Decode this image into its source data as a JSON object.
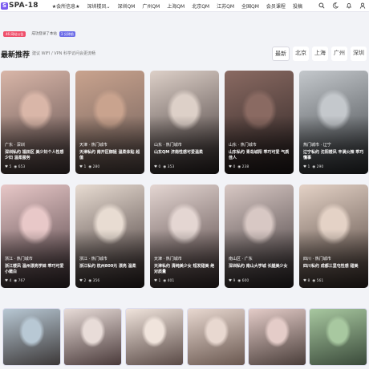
{
  "site": {
    "logo_letter": "S",
    "name": "SPA-18"
  },
  "nav": {
    "items": [
      {
        "label": "★会所信息★",
        "vip": true
      },
      {
        "label": "深圳楼凤⌄"
      },
      {
        "label": "深圳QM"
      },
      {
        "label": "广州QM"
      },
      {
        "label": "上海QM"
      },
      {
        "label": "北京QM"
      },
      {
        "label": "江苏QM"
      },
      {
        "label": "全国QM"
      },
      {
        "label": "会员课程"
      },
      {
        "label": "投稿"
      }
    ],
    "icons": [
      "search-icon",
      "moon-icon",
      "bell-icon",
      "user-icon"
    ]
  },
  "announce": {
    "tag": "46 网站公告",
    "text": "成功登录了本站",
    "time": "3 分钟前"
  },
  "section": {
    "title": "最新推荐",
    "subtitle": "建议 WIFI / VPN 科学访问会更流畅",
    "filters": [
      "最新",
      "北京",
      "上海",
      "广州",
      "深圳"
    ],
    "active_filter": "最新"
  },
  "cards": [
    {
      "region": "广东 · 深圳",
      "title": "深圳私约 福田区 美少妇个人性感少妇 温柔服务",
      "likes": "5",
      "views": "653",
      "c1": "#d9b6a8",
      "c2": "#5a4a4a"
    },
    {
      "region": "天津 · 热门城市",
      "title": "天津私约 南开区御姐 温柔体贴 超值",
      "likes": "1",
      "views": "280",
      "c1": "#c9a38e",
      "c2": "#6b5b57"
    },
    {
      "region": "山东 · 热门城市",
      "title": "山东QM 济南性感可爱温柔",
      "likes": "0",
      "views": "353",
      "c1": "#ddd0c8",
      "c2": "#3a3030"
    },
    {
      "region": "山东 · 热门城市",
      "title": "山东私约 青岛城阳 乖巧可爱 气质佳人",
      "likes": "0",
      "views": "238",
      "c1": "#8a6a62",
      "c2": "#2a2222"
    },
    {
      "region": "热门城市 · 辽宁",
      "title": "辽宁私约 沈阳楼凤 丰满火辣 乖巧懂事",
      "likes": "1",
      "views": "290",
      "c1": "#c4c8cc",
      "c2": "#3a3e42"
    },
    {
      "region": "浙江 · 热门城市",
      "title": "浙江楼凤 温州漂亮学妹 乖巧可爱 小嫩白",
      "likes": "4",
      "views": "767",
      "c1": "#e8c8c8",
      "c2": "#4a3a3e"
    },
    {
      "region": "浙江 · 热门城市",
      "title": "浙江私约 杭州800元 漂亮 温柔",
      "likes": "2",
      "views": "356",
      "c1": "#e8dcd2",
      "c2": "#3a2e2e"
    },
    {
      "region": "天津 · 热门城市",
      "title": "天津私约 清纯美少女 短发甜美 绝对质量",
      "likes": "1",
      "views": "401",
      "c1": "#e4d6d2",
      "c2": "#4a3a3a"
    },
    {
      "region": "南山区 · 广东",
      "title": "深圳私约 南山大学城 长腿美少女",
      "likes": "9",
      "views": "600",
      "c1": "#d8c8c4",
      "c2": "#3a3234"
    },
    {
      "region": "四川 · 热门城市",
      "title": "四川私约 成都三里屯性感 甜美",
      "likes": "8",
      "views": "561",
      "c1": "#e4d2c6",
      "c2": "#4a3c36"
    }
  ],
  "thumbs": [
    {
      "c1": "#b8c8d4",
      "c2": "#3c3838"
    },
    {
      "c1": "#e8dcd8",
      "c2": "#4a3a3a"
    },
    {
      "c1": "#f0e4dc",
      "c2": "#5a4a46"
    },
    {
      "c1": "#e8d8d0",
      "c2": "#6a5850"
    },
    {
      "c1": "#e4ccc8",
      "c2": "#4a3e3a"
    },
    {
      "c1": "#a8c8a0",
      "c2": "#3a4a3a"
    }
  ]
}
